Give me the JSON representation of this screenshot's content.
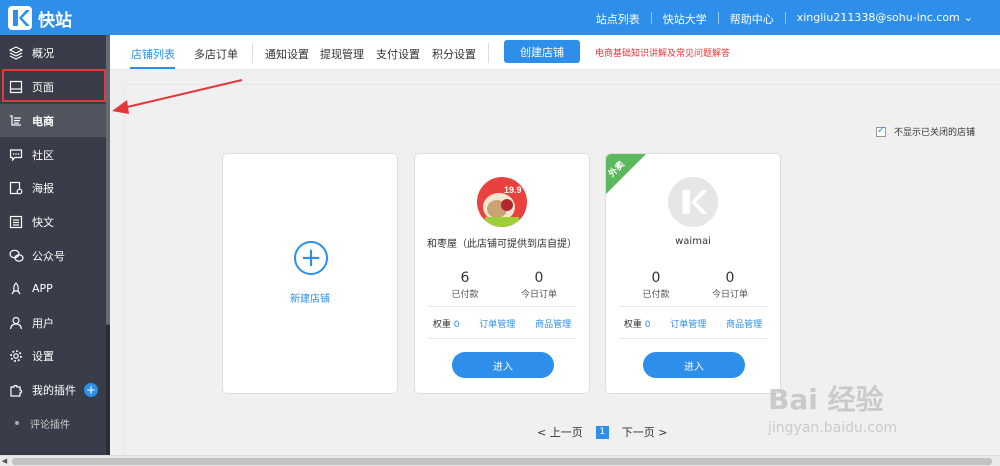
{
  "brand": {
    "name": "快站"
  },
  "top_nav": {
    "links": [
      "站点列表",
      "快站大学",
      "帮助中心",
      "xingliu211338@sohu-inc.com"
    ],
    "dropdown_icon": "chevron-down-icon"
  },
  "sidebar": {
    "items": [
      {
        "label": "概况",
        "icon": "layers-icon"
      },
      {
        "label": "页面",
        "icon": "page-icon"
      },
      {
        "label": "电商",
        "icon": "cart-icon"
      },
      {
        "label": "社区",
        "icon": "chat-icon"
      },
      {
        "label": "海报",
        "icon": "poster-icon"
      },
      {
        "label": "快文",
        "icon": "doc-icon"
      },
      {
        "label": "公众号",
        "icon": "wechat-icon"
      },
      {
        "label": "APP",
        "icon": "rocket-icon"
      },
      {
        "label": "用户",
        "icon": "user-icon"
      },
      {
        "label": "设置",
        "icon": "gear-icon"
      },
      {
        "label": "我的插件",
        "icon": "puzzle-icon"
      }
    ],
    "active": "电商",
    "plugins_add": "+",
    "sub_items": [
      "评论插件"
    ]
  },
  "tabs": {
    "items": [
      "店铺列表",
      "多店订单",
      "通知设置",
      "提现管理",
      "支付设置",
      "积分设置"
    ],
    "active": "店铺列表",
    "create_button": "创建店铺",
    "help_link": "电商基础知识讲解及常见问题解答"
  },
  "filters": {
    "hide_closed_label": "不显示已关闭的店铺",
    "hide_closed_checked": true
  },
  "new_store": {
    "label": "新建店铺",
    "icon": "plus-circle-icon"
  },
  "stores": [
    {
      "name": "和枣屋（此店铺可提供到店自提）",
      "paid": "6",
      "paid_label": "已付款",
      "today_orders": "0",
      "today_label": "今日订单",
      "weight_label": "权重",
      "weight": "0",
      "orders_link": "订单管理",
      "goods_link": "商品管理",
      "enter": "进入",
      "avatar_badge": "19.9"
    },
    {
      "name": "waimai",
      "ribbon": "外卖",
      "paid": "0",
      "paid_label": "已付款",
      "today_orders": "0",
      "today_label": "今日订单",
      "weight_label": "权重",
      "weight": "0",
      "orders_link": "订单管理",
      "goods_link": "商品管理",
      "enter": "进入"
    }
  ],
  "pagination": {
    "prev": "< 上一页",
    "current": "1",
    "next": "下一页 >"
  },
  "watermark": {
    "main": "Bai 经验",
    "sub": "jingyan.baidu.com"
  },
  "colors": {
    "primary": "#2d8fe9",
    "sidebar": "#393d49",
    "highlight": "#e2393a",
    "ribbon": "#5cb85c"
  }
}
